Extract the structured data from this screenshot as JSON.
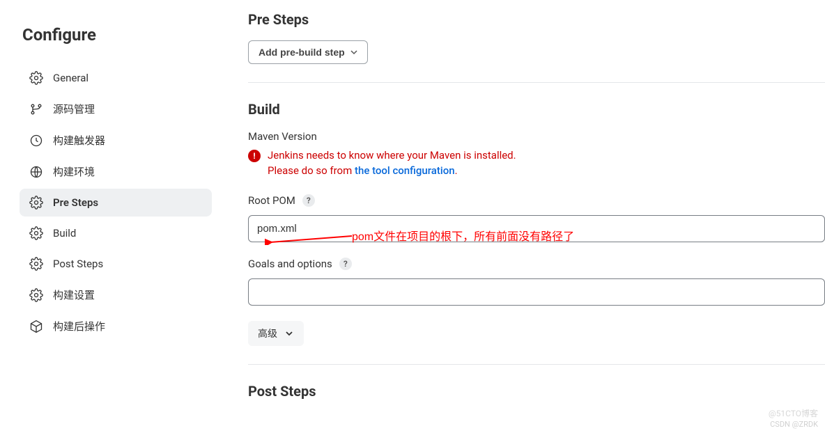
{
  "sidebar": {
    "title": "Configure",
    "items": [
      {
        "label": "General"
      },
      {
        "label": "源码管理"
      },
      {
        "label": "构建触发器"
      },
      {
        "label": "构建环境"
      },
      {
        "label": "Pre Steps"
      },
      {
        "label": "Build"
      },
      {
        "label": "Post Steps"
      },
      {
        "label": "构建设置"
      },
      {
        "label": "构建后操作"
      }
    ]
  },
  "presteps": {
    "heading": "Pre Steps",
    "add_button": "Add pre-build step"
  },
  "build": {
    "heading": "Build",
    "maven_label": "Maven Version",
    "error_line1": "Jenkins needs to know where your Maven is installed.",
    "error_line2_prefix": "Please do so from ",
    "error_link": "the tool configuration",
    "root_pom_label": "Root POM",
    "root_pom_value": "pom.xml",
    "goals_label": "Goals and options",
    "goals_value": "",
    "advanced_button": "高级"
  },
  "poststeps": {
    "heading": "Post Steps"
  },
  "annotation": {
    "text": "pom文件在项目的根下，所有前面没有路径了"
  },
  "watermarks": {
    "a": "@51CTO博客",
    "b": "CSDN @ZRDK"
  }
}
